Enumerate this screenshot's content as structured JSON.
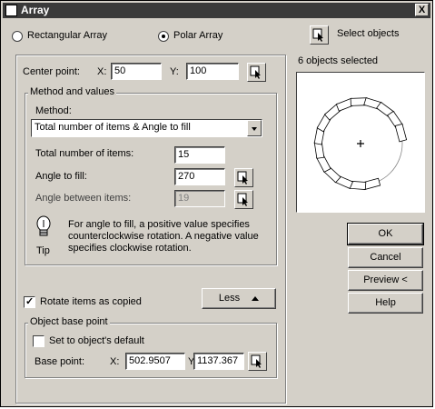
{
  "window": {
    "title": "Array",
    "close_label": "X"
  },
  "array_type": {
    "rectangular_label": "Rectangular Array",
    "polar_label": "Polar Array",
    "selected": "polar"
  },
  "select_objects": {
    "label": "Select objects",
    "status": "6 objects selected"
  },
  "center_point": {
    "label": "Center point:",
    "x_label": "X:",
    "x_value": "50",
    "y_label": "Y:",
    "y_value": "100"
  },
  "method_group": {
    "title": "Method and values",
    "method_label": "Method:",
    "method_value": "Total number of items & Angle to fill",
    "total_items_label": "Total number of items:",
    "total_items_value": "15",
    "angle_fill_label": "Angle to fill:",
    "angle_fill_value": "270",
    "angle_between_label": "Angle between items:",
    "angle_between_value": "19",
    "tip_label": "Tip",
    "tip_text": "For angle to fill, a positive value specifies counterclockwise rotation.  A negative value specifies clockwise rotation."
  },
  "rotate": {
    "label": "Rotate items as copied",
    "checked": true
  },
  "less_button": {
    "label": "Less"
  },
  "base_point_group": {
    "title": "Object base point",
    "default_label": "Set to object's default",
    "default_checked": false,
    "base_label": "Base point:",
    "x_label": "X:",
    "x_value": "502.9507",
    "y_label": "Y:",
    "y_value": "1137.367"
  },
  "buttons": {
    "ok": "OK",
    "cancel": "Cancel",
    "preview": "Preview <",
    "help": "Help"
  },
  "preview": {
    "item_count": 15,
    "angle_fill": 270
  }
}
